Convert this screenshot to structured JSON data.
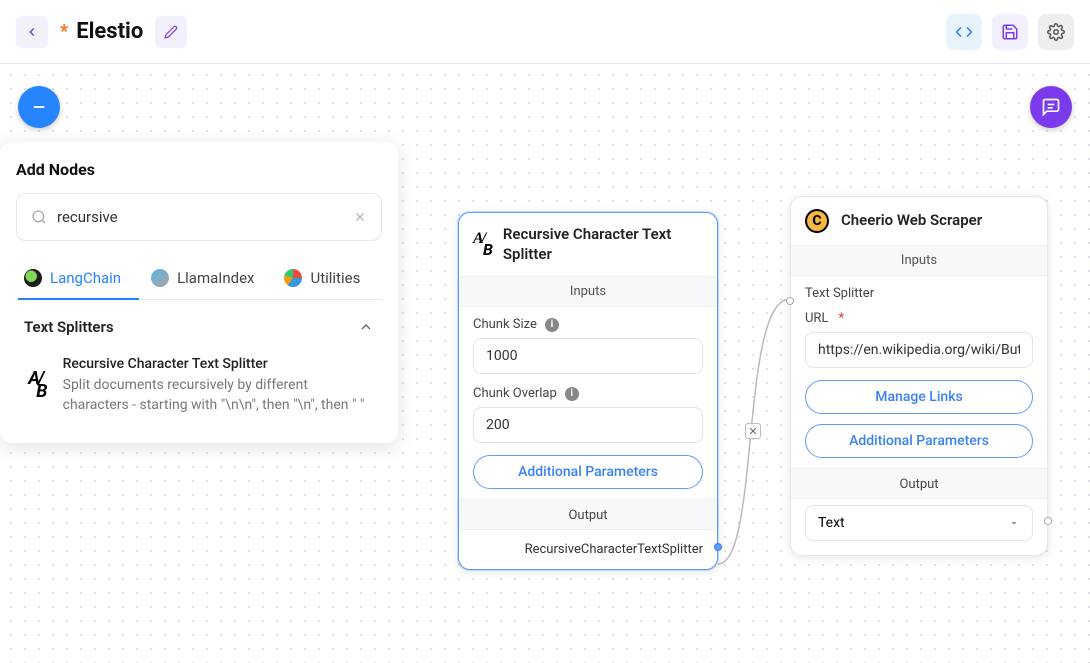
{
  "header": {
    "title": "Elestio",
    "modified_indicator": "*"
  },
  "sidebar": {
    "title": "Add Nodes",
    "search_value": "recursive",
    "tabs": [
      {
        "label": "LangChain"
      },
      {
        "label": "LlamaIndex"
      },
      {
        "label": "Utilities"
      }
    ],
    "section_title": "Text Splitters",
    "item": {
      "title": "Recursive Character Text Splitter",
      "desc": "Split documents recursively by different characters - starting with \"\\n\\n\", then \"\\n\", then \" \""
    }
  },
  "node1": {
    "title": "Recursive Character Text Splitter",
    "inputs_label": "Inputs",
    "chunk_size_label": "Chunk Size",
    "chunk_size_value": "1000",
    "chunk_overlap_label": "Chunk Overlap",
    "chunk_overlap_value": "200",
    "additional_params": "Additional Parameters",
    "output_label": "Output",
    "output_value": "RecursiveCharacterTextSplitter"
  },
  "node2": {
    "title": "Cheerio Web Scraper",
    "inputs_label": "Inputs",
    "text_splitter_label": "Text Splitter",
    "url_label": "URL",
    "url_value": "https://en.wikipedia.org/wiki/Butterfly",
    "manage_links": "Manage Links",
    "additional_params": "Additional Parameters",
    "output_label": "Output",
    "output_select": "Text"
  }
}
